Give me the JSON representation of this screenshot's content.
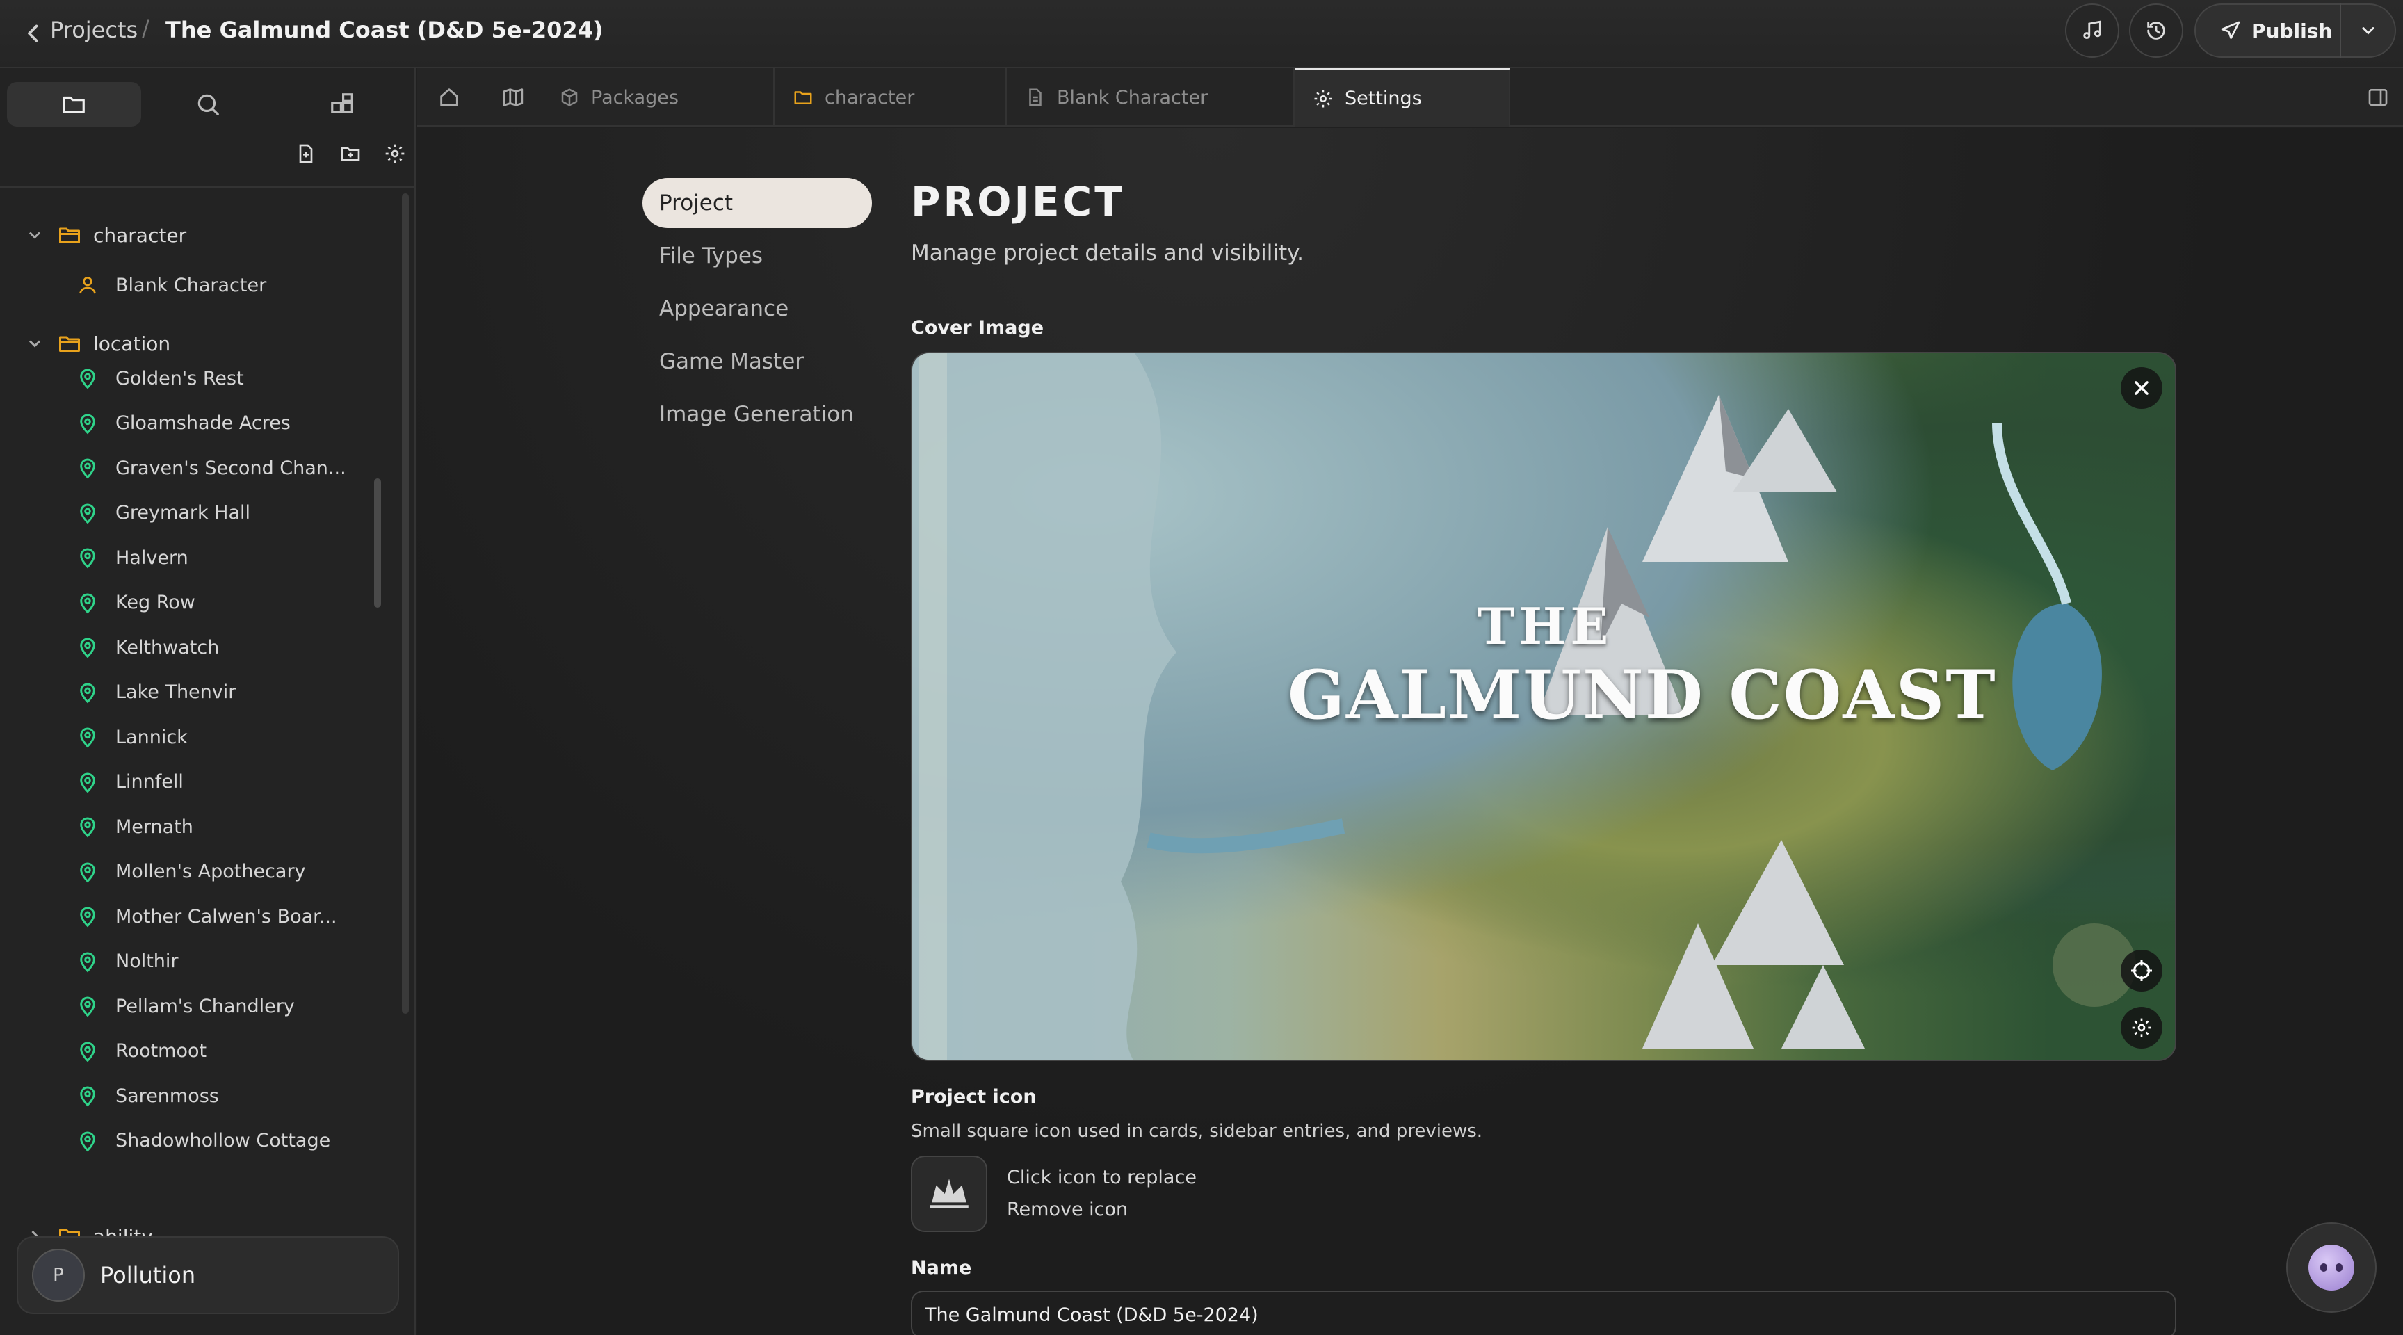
{
  "header": {
    "back_label": "Projects",
    "separator": "/",
    "project_title": "The Galmund Coast (D&D 5e-2024)",
    "publish_label": "Publish"
  },
  "sidebar": {
    "folders": [
      {
        "label": "character",
        "expanded": true
      },
      {
        "label": "location",
        "expanded": true
      },
      {
        "label": "ability",
        "expanded": false
      }
    ],
    "character_items": [
      "Blank Character"
    ],
    "location_items": [
      "Golden's Rest",
      "Gloamshade Acres",
      "Graven's Second Chan...",
      "Greymark Hall",
      "Halvern",
      "Keg Row",
      "Kelthwatch",
      "Lake Thenvir",
      "Lannick",
      "Linnfell",
      "Mernath",
      "Mollen's Apothecary",
      "Mother Calwen's Boar...",
      "Nolthir",
      "Pellam's Chandlery",
      "Rootmoot",
      "Sarenmoss",
      "Shadowhollow Cottage"
    ],
    "user": {
      "initial": "P",
      "name": "Pollution"
    }
  },
  "tabs": [
    {
      "label": "Packages",
      "icon": "package-icon"
    },
    {
      "label": "character",
      "icon": "folder-icon"
    },
    {
      "label": "Blank Character",
      "icon": "document-icon"
    },
    {
      "label": "Settings",
      "icon": "gear-icon",
      "active": true
    }
  ],
  "settings_nav": [
    "Project",
    "File Types",
    "Appearance",
    "Game Master",
    "Image Generation"
  ],
  "page": {
    "title": "PROJECT",
    "subtitle": "Manage project details and visibility.",
    "cover_label": "Cover Image",
    "cover_art": {
      "the": "THE",
      "name": "GALMUND COAST"
    },
    "icon_label": "Project icon",
    "icon_help": "Small square icon used in cards, sidebar entries, and previews.",
    "icon_replace": "Click icon to replace",
    "icon_remove": "Remove icon",
    "name_label": "Name",
    "name_value": "The Galmund Coast (D&D 5e-2024)"
  },
  "colors": {
    "folder": "#e8a21c",
    "location_pin": "#2fd38a",
    "character_icon": "#e8a21c",
    "active_nav_bg": "#ebe5df"
  }
}
